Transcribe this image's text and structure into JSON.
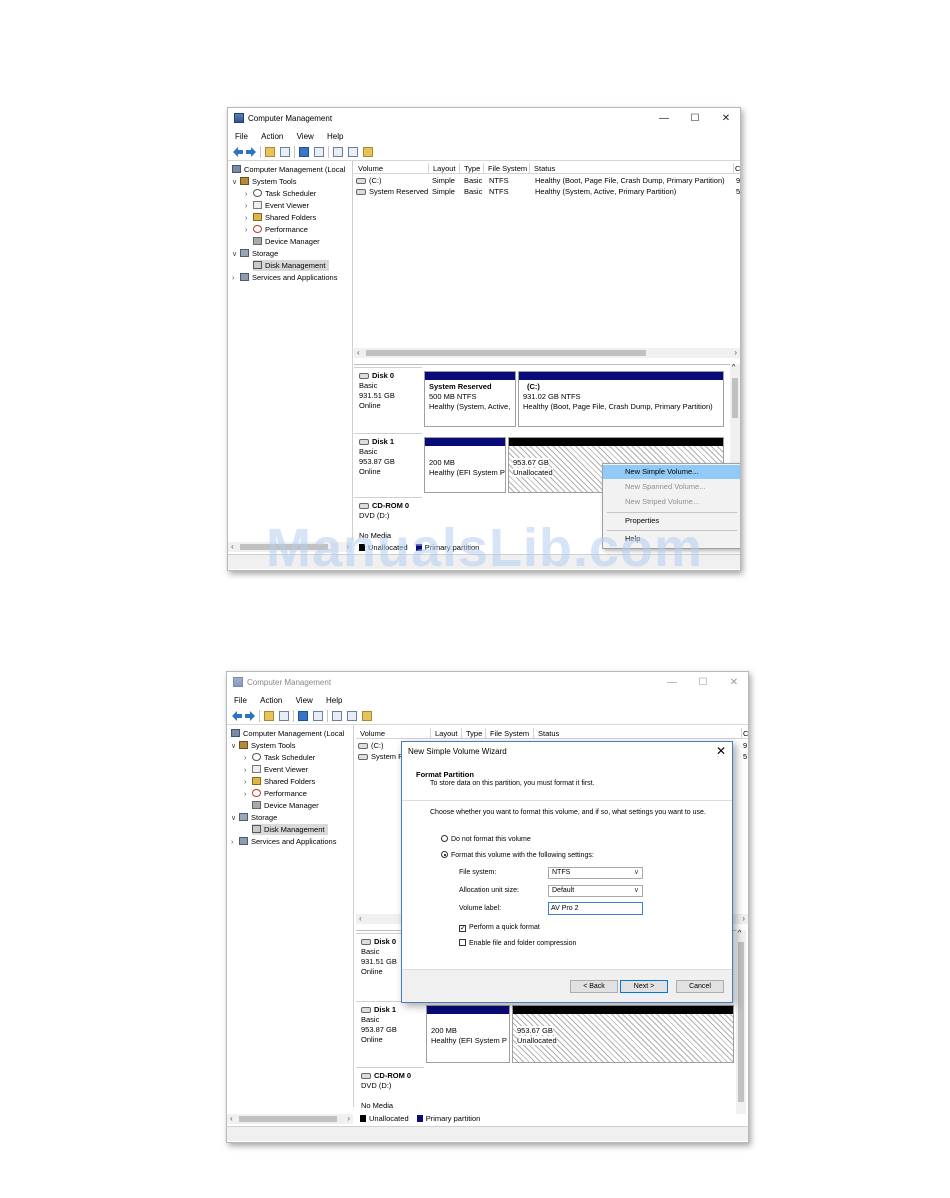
{
  "win1": {
    "title": "Computer Management",
    "controls": {
      "minimize": "—",
      "maximize": "☐",
      "close": "✕"
    },
    "menu": [
      "File",
      "Action",
      "View",
      "Help"
    ],
    "tree": [
      {
        "label": "Computer Management (Local",
        "icon": "computer-icon"
      },
      {
        "label": "System Tools",
        "icon": "tools-icon"
      },
      {
        "label": "Task Scheduler",
        "icon": "clock-icon"
      },
      {
        "label": "Event Viewer",
        "icon": "event-viewer-icon"
      },
      {
        "label": "Shared Folders",
        "icon": "shared-folders-icon"
      },
      {
        "label": "Performance",
        "icon": "performance-icon"
      },
      {
        "label": "Device Manager",
        "icon": "device-manager-icon"
      },
      {
        "label": "Storage",
        "icon": "storage-icon"
      },
      {
        "label": "Disk Management",
        "icon": "disk-icon"
      },
      {
        "label": "Services and Applications",
        "icon": "services-icon"
      }
    ],
    "columns": [
      "Volume",
      "Layout",
      "Type",
      "File System",
      "Status",
      "C"
    ],
    "rows": [
      {
        "volume": "(C:)",
        "layout": "Simple",
        "type": "Basic",
        "fs": "NTFS",
        "status": "Healthy (Boot, Page File, Crash Dump, Primary Partition)",
        "extra": "9"
      },
      {
        "volume": "System Reserved",
        "layout": "Simple",
        "type": "Basic",
        "fs": "NTFS",
        "status": "Healthy (System, Active, Primary Partition)",
        "extra": "5"
      }
    ],
    "disks": [
      {
        "name": "Disk 0",
        "type": "Basic",
        "size": "931.51 GB",
        "state": "Online",
        "parts": [
          {
            "title": "System Reserved",
            "line1": "500 MB NTFS",
            "line2": "Healthy (System, Active,"
          },
          {
            "title": "(C:)",
            "line1": "931.02 GB NTFS",
            "line2": "Healthy (Boot, Page File, Crash Dump, Primary Partition)"
          }
        ]
      },
      {
        "name": "Disk 1",
        "type": "Basic",
        "size": "953.87 GB",
        "state": "Online",
        "parts": [
          {
            "line1": "200 MB",
            "line2": "Healthy (EFI System P"
          },
          {
            "line1": "953.67 GB",
            "line2": "Unallocated"
          }
        ]
      },
      {
        "name": "CD-ROM 0",
        "type": "DVD (D:)",
        "state": "No Media"
      }
    ],
    "legend": {
      "unallocated": "Unallocated",
      "primary": "Primary partition"
    },
    "context_menu": [
      {
        "label": "New Simple Volume...",
        "state": "highlighted"
      },
      {
        "label": "New Spanned Volume...",
        "state": "disabled"
      },
      {
        "label": "New Striped Volume...",
        "state": "disabled"
      },
      {
        "label": "Properties",
        "state": "enabled"
      },
      {
        "label": "Help",
        "state": "enabled"
      }
    ]
  },
  "win2": {
    "title": "Computer Management",
    "controls": {
      "minimize": "—",
      "maximize": "☐",
      "close": "✕"
    },
    "menu": [
      "File",
      "Action",
      "View",
      "Help"
    ],
    "tree": [
      {
        "label": "Computer Management (Local"
      },
      {
        "label": "System Tools"
      },
      {
        "label": "Task Scheduler"
      },
      {
        "label": "Event Viewer"
      },
      {
        "label": "Shared Folders"
      },
      {
        "label": "Performance"
      },
      {
        "label": "Device Manager"
      },
      {
        "label": "Storage"
      },
      {
        "label": "Disk Management"
      },
      {
        "label": "Services and Applications"
      }
    ],
    "columns": [
      "Volume",
      "Layout",
      "Type",
      "File System",
      "Status",
      "C"
    ],
    "rows": [
      {
        "volume": "(C:)",
        "extra": "9"
      },
      {
        "volume": "System R",
        "extra": "5"
      }
    ],
    "disks": [
      {
        "name": "Disk 0",
        "type": "Basic",
        "size": "931.51 GB",
        "state": "Online"
      },
      {
        "name": "Disk 1",
        "type": "Basic",
        "size": "953.87 GB",
        "state": "Online",
        "parts": [
          {
            "line1": "200 MB",
            "line2": "Healthy (EFI System P"
          },
          {
            "line1": "953.67 GB",
            "line2": "Unallocated"
          }
        ]
      },
      {
        "name": "CD-ROM 0",
        "type": "DVD (D:)",
        "state": "No Media"
      }
    ],
    "legend": {
      "unallocated": "Unallocated",
      "primary": "Primary partition"
    },
    "wizard": {
      "title": "New Simple Volume Wizard",
      "close": "✕",
      "header_title": "Format Partition",
      "header_sub": "To store data on this partition, you must format it first.",
      "prompt": "Choose whether you want to format this volume, and if so, what settings you want to use.",
      "option_no": "Do not format this volume",
      "option_yes": "Format this volume with the following settings:",
      "fs_label": "File system:",
      "fs_value": "NTFS",
      "alloc_label": "Allocation unit size:",
      "alloc_value": "Default",
      "vol_label": "Volume label:",
      "vol_value": "AV Pro 2",
      "quick": "Perform a quick format",
      "compress": "Enable file and folder compression",
      "back": "< Back",
      "next": "Next >",
      "cancel": "Cancel"
    }
  },
  "watermark": "ManualsLib.com",
  "colors": {
    "primary_partition": "#0a0a78",
    "unallocated": "#000000",
    "menu_highlight": "#91c9f7",
    "selection": "#d9d9d9"
  }
}
